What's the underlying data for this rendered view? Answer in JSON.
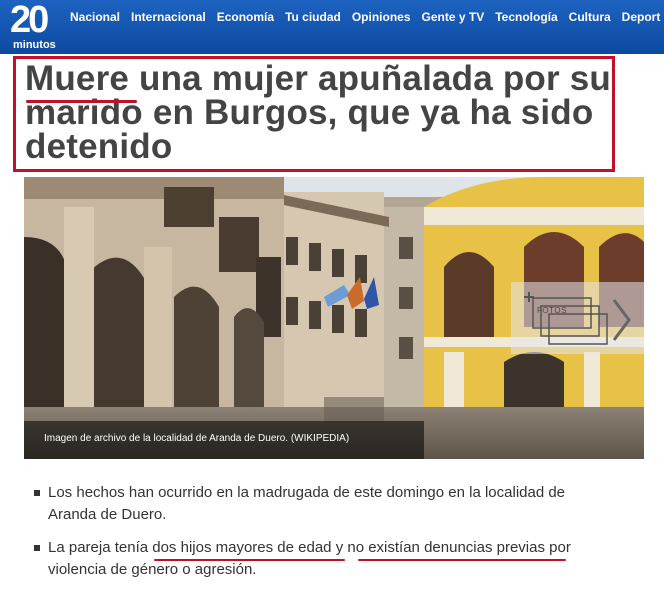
{
  "nav": {
    "logo": {
      "number": "20",
      "word": "minutos"
    },
    "items": [
      {
        "label": "Nacional"
      },
      {
        "label": "Internacional"
      },
      {
        "label": "Economía"
      },
      {
        "label": "Tu ciudad"
      },
      {
        "label": "Opiniones"
      },
      {
        "label": "Gente y TV"
      },
      {
        "label": "Tecnología"
      },
      {
        "label": "Cultura"
      },
      {
        "label": "Deport"
      }
    ]
  },
  "article": {
    "headline_first_word": "Muere",
    "headline_rest": " una mujer apuñalada por su marido en Burgos, que ya ha sido detenido",
    "photo": {
      "caption": "Imagen de archivo de la localidad de Aranda de Duero. (WIKIPEDIA)",
      "gallery_label": "FOTOS",
      "gallery_icon": "photo-gallery-icon",
      "next_icon": "chevron-right-icon"
    },
    "bullets": [
      {
        "text": "Los hechos han ocurrido en la madrugada de este domingo en la localidad de Aranda de Duero."
      },
      {
        "text": "La pareja tenía dos hijos mayores de edad y no existían denuncias previas por violencia de género o agresión."
      }
    ]
  },
  "colors": {
    "nav_background": "#0c4aa0",
    "highlight": "#c0102b",
    "headline_text": "#444444",
    "body_text": "#333333"
  }
}
